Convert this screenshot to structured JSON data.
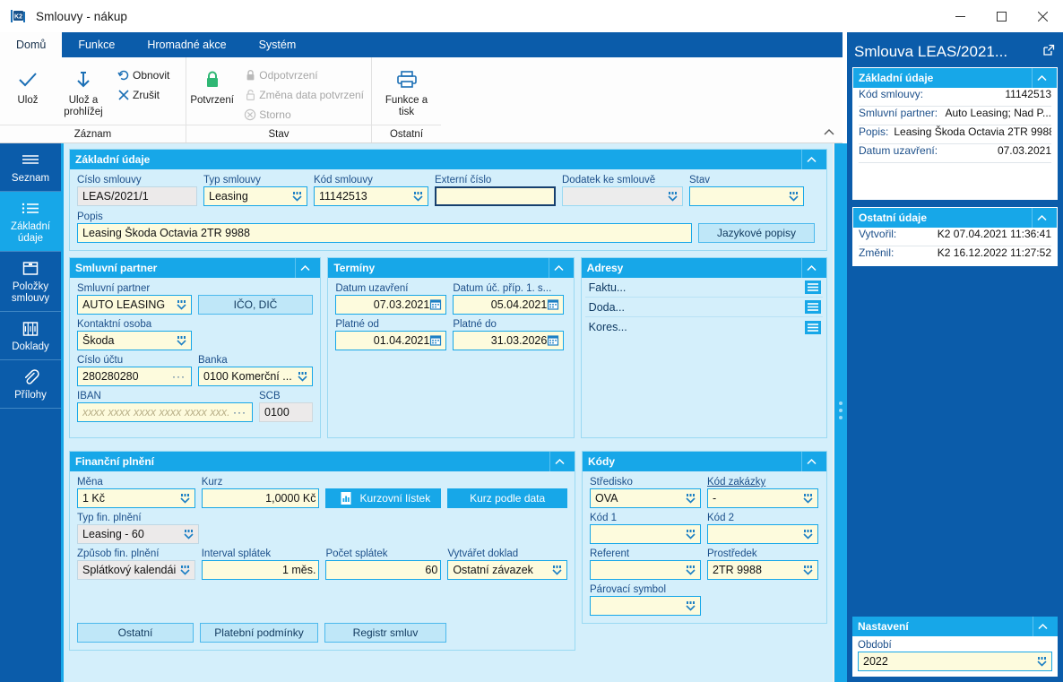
{
  "window": {
    "title": "Smlouvy - nákup",
    "app_icon": "k2-logo-icon",
    "minimize": "minimize-icon",
    "maximize": "maximize-icon",
    "close": "close-icon"
  },
  "ribbon": {
    "tabs": [
      {
        "label": "Domů",
        "active": true
      },
      {
        "label": "Funkce",
        "active": false
      },
      {
        "label": "Hromadné akce",
        "active": false
      },
      {
        "label": "Systém",
        "active": false
      }
    ],
    "groups": [
      {
        "name": "Záznam",
        "big_buttons": [
          {
            "label": "Ulož",
            "icon": "check-icon"
          },
          {
            "label": "Ulož a prohlížej",
            "icon": "save-arrow-icon"
          }
        ],
        "small_buttons": [
          {
            "label": "Obnovit",
            "icon": "refresh-icon",
            "disabled": false
          },
          {
            "label": "Zrušit",
            "icon": "cancel-x-icon",
            "disabled": false
          }
        ]
      },
      {
        "name": "Stav",
        "big_buttons": [
          {
            "label": "Potvrzení",
            "icon": "lock-green-icon"
          }
        ],
        "small_buttons": [
          {
            "label": "Odpotvrzení",
            "icon": "lock-icon",
            "disabled": true
          },
          {
            "label": "Změna data potvrzení",
            "icon": "lock-open-icon",
            "disabled": true
          },
          {
            "label": "Storno",
            "icon": "storno-circle-x-icon",
            "disabled": true
          }
        ]
      },
      {
        "name": "Ostatní",
        "big_buttons": [
          {
            "label": "Funkce a tisk",
            "icon": "printer-icon"
          }
        ],
        "small_buttons": []
      }
    ],
    "collapse_icon": "chevron-up-icon"
  },
  "sidebar": {
    "items": [
      {
        "label": "Seznam",
        "icon": "list-lines-icon",
        "active": false
      },
      {
        "label": "Základní údaje",
        "icon": "bullet-list-icon",
        "active": true
      },
      {
        "label": "Položky smlouvy",
        "icon": "box-icon",
        "active": false
      },
      {
        "label": "Doklady",
        "icon": "documents-icon",
        "active": false
      },
      {
        "label": "Přílohy",
        "icon": "paperclip-icon",
        "active": false
      }
    ]
  },
  "main": {
    "zakladni_udaje": {
      "title": "Základní údaje",
      "collapse_icon": "chevron-up-icon",
      "fields": [
        {
          "label": "Číslo smlouvy",
          "value": "LEAS/2021/1",
          "style": "readonly",
          "dropdown": false
        },
        {
          "label": "Typ smlouvy",
          "value": "Leasing",
          "style": "normal",
          "dropdown": true
        },
        {
          "label": "Kód smlouvy",
          "value": "11142513",
          "style": "normal",
          "dropdown": true
        },
        {
          "label": "Externí číslo",
          "value": "",
          "style": "focused",
          "dropdown": false
        },
        {
          "label": "Dodatek ke smlouvě",
          "value": "",
          "style": "disabled",
          "dropdown": true
        },
        {
          "label": "Stav",
          "value": "",
          "style": "normal",
          "dropdown": true
        }
      ],
      "popis_label": "Popis",
      "popis_value": "Leasing Škoda Octavia 2TR 9988",
      "jazykove_popisy_button": "Jazykové popisy"
    },
    "smluvni_partner": {
      "title": "Smluvní partner",
      "collapse_icon": "chevron-up-icon",
      "partner_label": "Smluvní partner",
      "partner_value": "AUTO LEASING",
      "ico_dic_button": "IČO, DIČ",
      "kontaktni_osoba_label": "Kontaktní osoba",
      "kontaktni_osoba_value": "Škoda",
      "cislo_uctu_label": "Číslo účtu",
      "cislo_uctu_value": "280280280",
      "banka_label": "Banka",
      "banka_value": "0100 Komerční ...",
      "iban_label": "IBAN",
      "iban_placeholder": "xxxx xxxx xxxx xxxx xxxx xxx...",
      "scb_label": "SCB",
      "scb_value": "0100"
    },
    "terminy": {
      "title": "Termíny",
      "collapse_icon": "chevron-up-icon",
      "fields": [
        {
          "label": "Datum uzavření",
          "value": "07.03.2021",
          "icon": "calendar-icon"
        },
        {
          "label": "Datum úč. příp. 1. s...",
          "value": "05.04.2021",
          "icon": "calendar-icon"
        },
        {
          "label": "Platné od",
          "value": "01.04.2021",
          "icon": "calendar-icon"
        },
        {
          "label": "Platné do",
          "value": "31.03.2026",
          "icon": "calendar-icon"
        }
      ]
    },
    "adresy": {
      "title": "Adresy",
      "collapse_icon": "chevron-up-icon",
      "rows": [
        {
          "label": "Faktu...",
          "icon": "address-lines-icon"
        },
        {
          "label": "Doda...",
          "icon": "address-lines-icon"
        },
        {
          "label": "Kores...",
          "icon": "address-lines-icon"
        }
      ]
    },
    "financni_plneni": {
      "title": "Finanční plnění",
      "collapse_icon": "chevron-up-icon",
      "mena_label": "Měna",
      "mena_value": "1 Kč",
      "kurz_label": "Kurz",
      "kurz_value": "1,0000 Kč",
      "kurzovni_listek_button": "Kurzovní lístek",
      "kurzovni_listek_icon": "chart-doc-icon",
      "kurz_podle_data_button": "Kurz podle data",
      "typ_fin_plneni_label": "Typ fin. plnění",
      "typ_fin_plneni_value": "Leasing - 60",
      "zpusob_fin_plneni_label": "Způsob fin. plnění",
      "zpusob_fin_plneni_value": "Splátkový kalendái",
      "interval_splatek_label": "Interval splátek",
      "interval_splatek_value": "1 měs.",
      "pocet_splatek_label": "Počet splátek",
      "pocet_splatek_value": "60",
      "vytvaret_doklad_label": "Vytvářet doklad",
      "vytvaret_doklad_value": "Ostatní závazek"
    },
    "kody": {
      "title": "Kódy",
      "collapse_icon": "chevron-up-icon",
      "fields": [
        {
          "label": "Středisko",
          "value": "OVA",
          "underline_first": false
        },
        {
          "label": "Kód zakázky",
          "value": "-",
          "underline_first": true
        },
        {
          "label": "Kód 1",
          "value": "",
          "underline_first": false
        },
        {
          "label": "Kód 2",
          "value": "",
          "underline_first": false
        },
        {
          "label": "Referent",
          "value": "",
          "underline_first": false
        },
        {
          "label": "Prostředek",
          "value": "2TR 9988",
          "underline_first": false
        },
        {
          "label": "Párovací symbol",
          "value": "",
          "underline_first": false
        }
      ]
    },
    "bottom_buttons": [
      {
        "label": "Ostatní"
      },
      {
        "label": "Platební podmínky"
      },
      {
        "label": "Registr smluv"
      }
    ]
  },
  "rightpane": {
    "title": "Smlouva LEAS/2021...",
    "popout_icon": "external-link-icon",
    "zakladni_udaje": {
      "title": "Základní údaje",
      "collapse_icon": "chevron-up-icon",
      "rows": [
        {
          "key": "Kód smlouvy:",
          "value": "11142513"
        },
        {
          "key": "Smluvní partner:",
          "value": "Auto Leasing; Nad P..."
        },
        {
          "key": "Popis:",
          "value": "Leasing Škoda Octavia 2TR 9988"
        },
        {
          "key": "Datum uzavření:",
          "value": "07.03.2021"
        }
      ]
    },
    "ostatni_udaje": {
      "title": "Ostatní údaje",
      "collapse_icon": "chevron-up-icon",
      "rows": [
        {
          "key": "Vytvořil:",
          "value": "K2 07.04.2021 11:36:41"
        },
        {
          "key": "Změnil:",
          "value": "K2 16.12.2022 11:27:52"
        }
      ]
    },
    "nastaveni": {
      "title": "Nastavení",
      "collapse_icon": "chevron-up-icon",
      "obdobi_label": "Období",
      "obdobi_value": "2022"
    }
  },
  "colors": {
    "ribbon_blue": "#0b5caa",
    "accent_cyan": "#17a7e8",
    "panel_bg": "#d4effb",
    "field_yellow": "#fdfbdd",
    "label_blue": "#1c4f8a",
    "lock_green": "#2fb774"
  }
}
